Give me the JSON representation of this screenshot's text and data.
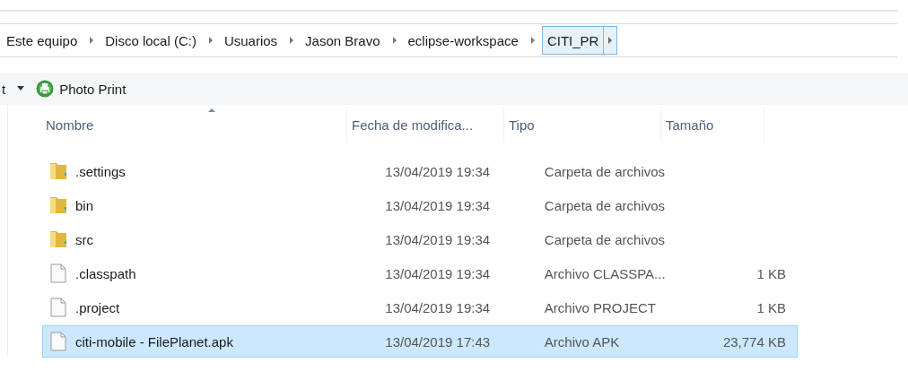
{
  "breadcrumb": [
    {
      "label": "Este equipo",
      "selected": false
    },
    {
      "label": "Disco local (C:)",
      "selected": false
    },
    {
      "label": "Usuarios",
      "selected": false
    },
    {
      "label": "Jason Bravo",
      "selected": false
    },
    {
      "label": "eclipse-workspace",
      "selected": false
    },
    {
      "label": "CITI_PR",
      "selected": true
    }
  ],
  "toolbar": {
    "cut_label": "t",
    "item": "Photo Print"
  },
  "table": {
    "columns": [
      "Nombre",
      "Fecha de modifica...",
      "Tipo",
      "Tamaño"
    ],
    "rows": [
      {
        "kind": "folder",
        "name": ".settings",
        "date": "13/04/2019 19:34",
        "type": "Carpeta de archivos",
        "selected": false
      },
      {
        "kind": "folder",
        "name": "bin",
        "date": "13/04/2019 19:34",
        "type": "Carpeta de archivos",
        "selected": false
      },
      {
        "kind": "folder",
        "name": "src",
        "date": "13/04/2019 19:34",
        "type": "Carpeta de archivos",
        "selected": false
      },
      {
        "kind": "file",
        "name": ".classpath",
        "date": "13/04/2019 19:34",
        "type": "Archivo CLASSPA...",
        "size": "1 KB",
        "selected": false
      },
      {
        "kind": "file",
        "name": ".project",
        "date": "13/04/2019 19:34",
        "type": "Archivo PROJECT",
        "size": "1 KB",
        "selected": false
      },
      {
        "kind": "file",
        "name": "citi-mobile - FilePlanet.apk",
        "date": "13/04/2019 17:43",
        "type": "Archivo APK",
        "size": "23,774 KB",
        "selected": true
      }
    ]
  }
}
